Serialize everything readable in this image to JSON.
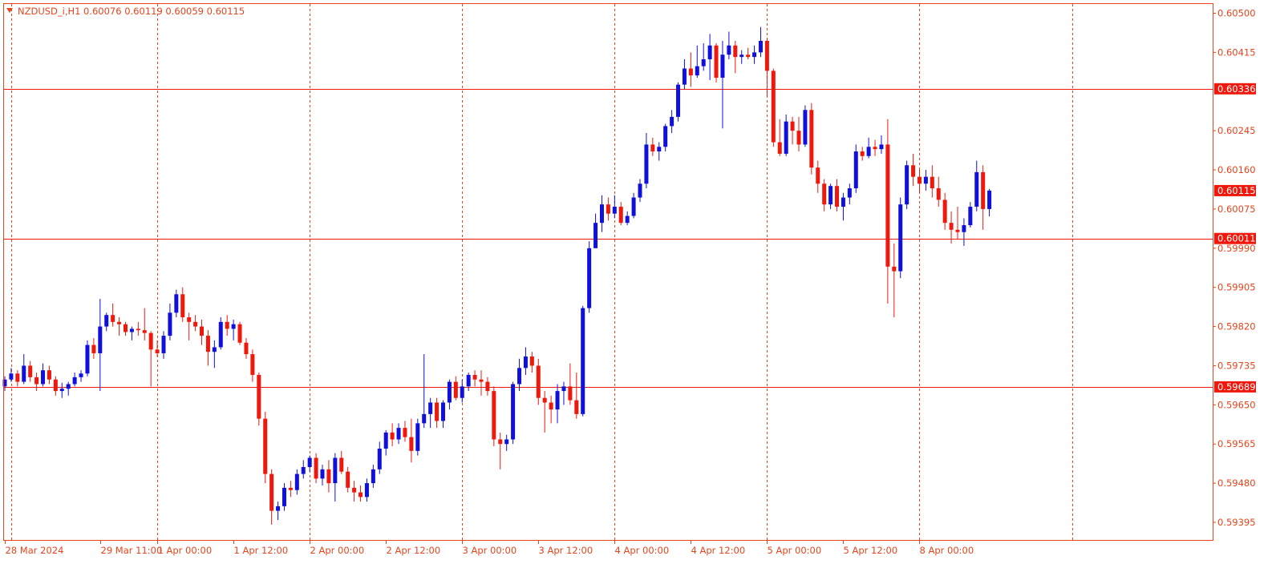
{
  "header": {
    "symbol": "NZDUSD_i,H1",
    "ohlc": "0.60076 0.60119 0.60059 0.60115"
  },
  "colors": {
    "frame": "#e8441c",
    "grid": "#e8441c",
    "bull": "#1010dd",
    "bear": "#f0180c",
    "hline": "#f0180c",
    "text": "#e8441c",
    "label_bg": "#f0180c",
    "label_text": "#ffffff",
    "background": "#ffffff"
  },
  "chart_data": {
    "type": "candlestick",
    "timeframe": "H1",
    "ylim": [
      0.59355,
      0.6052
    ],
    "y_ticks": [
      "0.60500",
      "0.60415",
      "0.60245",
      "0.60160",
      "0.60075",
      "0.59990",
      "0.59905",
      "0.59820",
      "0.59735",
      "0.59650",
      "0.59565",
      "0.59480",
      "0.59395"
    ],
    "x_ticks": [
      {
        "label": "28 Mar 2024",
        "bar": 0
      },
      {
        "label": "29 Mar 11:00",
        "bar": 15
      },
      {
        "label": "1 Apr 00:00",
        "bar": 24
      },
      {
        "label": "1 Apr 12:00",
        "bar": 36
      },
      {
        "label": "2 Apr 00:00",
        "bar": 48
      },
      {
        "label": "2 Apr 12:00",
        "bar": 60
      },
      {
        "label": "3 Apr 00:00",
        "bar": 72
      },
      {
        "label": "3 Apr 12:00",
        "bar": 84
      },
      {
        "label": "4 Apr 00:00",
        "bar": 96
      },
      {
        "label": "4 Apr 12:00",
        "bar": 108
      },
      {
        "label": "5 Apr 00:00",
        "bar": 120
      },
      {
        "label": "5 Apr 12:00",
        "bar": 132
      },
      {
        "label": "8 Apr 00:00",
        "bar": 144
      }
    ],
    "vgrid_bars": [
      1,
      24,
      48,
      72,
      96,
      120,
      144,
      168
    ],
    "price_levels": [
      {
        "label": "0.60336",
        "value": 0.60336
      },
      {
        "label": "0.60011",
        "value": 0.60011
      },
      {
        "label": "0.59689",
        "value": 0.59689
      }
    ],
    "current_price": {
      "label": "0.60115",
      "value": 0.60115
    },
    "candles": [
      [
        0.5969,
        0.59712,
        0.5968,
        0.59705
      ],
      [
        0.59705,
        0.5973,
        0.597,
        0.59718
      ],
      [
        0.59718,
        0.59725,
        0.5969,
        0.597
      ],
      [
        0.597,
        0.5976,
        0.59695,
        0.59735
      ],
      [
        0.59735,
        0.59745,
        0.597,
        0.5971
      ],
      [
        0.5971,
        0.5972,
        0.5968,
        0.59695
      ],
      [
        0.59695,
        0.5974,
        0.5969,
        0.59725
      ],
      [
        0.59725,
        0.59735,
        0.59695,
        0.59705
      ],
      [
        0.59705,
        0.59712,
        0.5967,
        0.5968
      ],
      [
        0.5968,
        0.59698,
        0.59665,
        0.59685
      ],
      [
        0.59685,
        0.597,
        0.5967,
        0.59695
      ],
      [
        0.59695,
        0.5972,
        0.5969,
        0.5971
      ],
      [
        0.5971,
        0.59725,
        0.597,
        0.59718
      ],
      [
        0.59718,
        0.5979,
        0.59712,
        0.5978
      ],
      [
        0.5978,
        0.59795,
        0.5975,
        0.59762
      ],
      [
        0.59762,
        0.5988,
        0.5968,
        0.5982
      ],
      [
        0.5982,
        0.5985,
        0.5981,
        0.59845
      ],
      [
        0.59845,
        0.5987,
        0.5982,
        0.5983
      ],
      [
        0.5983,
        0.5984,
        0.598,
        0.59825
      ],
      [
        0.59825,
        0.5983,
        0.598,
        0.59808
      ],
      [
        0.59808,
        0.5982,
        0.5979,
        0.59815
      ],
      [
        0.59815,
        0.5983,
        0.598,
        0.59812
      ],
      [
        0.59812,
        0.5986,
        0.5979,
        0.59806
      ],
      [
        0.59806,
        0.5981,
        0.5969,
        0.5977
      ],
      [
        0.5977,
        0.5979,
        0.59755,
        0.59762
      ],
      [
        0.59762,
        0.5981,
        0.5975,
        0.598
      ],
      [
        0.598,
        0.5987,
        0.5979,
        0.5985
      ],
      [
        0.5985,
        0.599,
        0.5984,
        0.5989
      ],
      [
        0.5989,
        0.59905,
        0.5983,
        0.5984
      ],
      [
        0.5984,
        0.5985,
        0.5979,
        0.5983
      ],
      [
        0.5983,
        0.59845,
        0.5981,
        0.5982
      ],
      [
        0.5982,
        0.59835,
        0.5978,
        0.598
      ],
      [
        0.598,
        0.59812,
        0.59735,
        0.59765
      ],
      [
        0.59765,
        0.5979,
        0.5973,
        0.59775
      ],
      [
        0.59775,
        0.5984,
        0.5977,
        0.5983
      ],
      [
        0.5983,
        0.59845,
        0.598,
        0.59815
      ],
      [
        0.59815,
        0.59835,
        0.5979,
        0.59825
      ],
      [
        0.59825,
        0.5983,
        0.5978,
        0.59785
      ],
      [
        0.59785,
        0.59795,
        0.5975,
        0.5976
      ],
      [
        0.5976,
        0.5977,
        0.597,
        0.59715
      ],
      [
        0.59715,
        0.5972,
        0.59605,
        0.5962
      ],
      [
        0.5962,
        0.59635,
        0.5948,
        0.595
      ],
      [
        0.595,
        0.5951,
        0.5939,
        0.5942
      ],
      [
        0.5942,
        0.5944,
        0.594,
        0.5943
      ],
      [
        0.5943,
        0.5948,
        0.5942,
        0.5947
      ],
      [
        0.5947,
        0.59485,
        0.5945,
        0.59465
      ],
      [
        0.59465,
        0.5951,
        0.59455,
        0.595
      ],
      [
        0.595,
        0.5953,
        0.5949,
        0.59515
      ],
      [
        0.59515,
        0.5954,
        0.59505,
        0.59535
      ],
      [
        0.59535,
        0.59545,
        0.5948,
        0.5949
      ],
      [
        0.5949,
        0.5952,
        0.59475,
        0.5951
      ],
      [
        0.5951,
        0.5953,
        0.5946,
        0.5948
      ],
      [
        0.5948,
        0.59545,
        0.5944,
        0.59535
      ],
      [
        0.59535,
        0.5955,
        0.595,
        0.59505
      ],
      [
        0.59505,
        0.59515,
        0.5946,
        0.5947
      ],
      [
        0.5947,
        0.59485,
        0.5944,
        0.5946
      ],
      [
        0.5946,
        0.59475,
        0.5944,
        0.5945
      ],
      [
        0.5945,
        0.5949,
        0.5944,
        0.5948
      ],
      [
        0.5948,
        0.5952,
        0.5947,
        0.5951
      ],
      [
        0.5951,
        0.5957,
        0.595,
        0.59555
      ],
      [
        0.59555,
        0.59595,
        0.5954,
        0.5959
      ],
      [
        0.5959,
        0.5961,
        0.5956,
        0.59575
      ],
      [
        0.59575,
        0.5961,
        0.59565,
        0.596
      ],
      [
        0.596,
        0.59615,
        0.5957,
        0.5958
      ],
      [
        0.5958,
        0.5962,
        0.59525,
        0.5955
      ],
      [
        0.5955,
        0.5962,
        0.5954,
        0.5961
      ],
      [
        0.5961,
        0.5976,
        0.596,
        0.5963
      ],
      [
        0.5963,
        0.59665,
        0.596,
        0.59655
      ],
      [
        0.59655,
        0.59665,
        0.596,
        0.59615
      ],
      [
        0.59615,
        0.5966,
        0.596,
        0.59655
      ],
      [
        0.59655,
        0.59705,
        0.5964,
        0.597
      ],
      [
        0.597,
        0.59712,
        0.5966,
        0.59665
      ],
      [
        0.59665,
        0.59705,
        0.59655,
        0.5969
      ],
      [
        0.5969,
        0.5972,
        0.5968,
        0.59715
      ],
      [
        0.59715,
        0.59725,
        0.5969,
        0.59705
      ],
      [
        0.59705,
        0.59725,
        0.5967,
        0.597
      ],
      [
        0.597,
        0.5971,
        0.5967,
        0.5968
      ],
      [
        0.5968,
        0.5969,
        0.5956,
        0.59575
      ],
      [
        0.59575,
        0.5959,
        0.5951,
        0.59565
      ],
      [
        0.59565,
        0.59585,
        0.5955,
        0.59575
      ],
      [
        0.59575,
        0.597,
        0.59565,
        0.59695
      ],
      [
        0.59695,
        0.5975,
        0.5968,
        0.5973
      ],
      [
        0.5973,
        0.59775,
        0.59715,
        0.59755
      ],
      [
        0.59755,
        0.59765,
        0.5972,
        0.59735
      ],
      [
        0.59735,
        0.5975,
        0.5965,
        0.59665
      ],
      [
        0.59665,
        0.5968,
        0.5959,
        0.59655
      ],
      [
        0.59655,
        0.5967,
        0.5961,
        0.5964
      ],
      [
        0.5964,
        0.59695,
        0.5961,
        0.5968
      ],
      [
        0.5968,
        0.597,
        0.5965,
        0.5969
      ],
      [
        0.5969,
        0.5974,
        0.5965,
        0.5966
      ],
      [
        0.5966,
        0.5972,
        0.5962,
        0.5963
      ],
      [
        0.5963,
        0.59865,
        0.59625,
        0.5986
      ],
      [
        0.5986,
        0.60005,
        0.5985,
        0.5999
      ],
      [
        0.5999,
        0.60065,
        0.5999,
        0.60045
      ],
      [
        0.60045,
        0.60105,
        0.60025,
        0.60085
      ],
      [
        0.60085,
        0.601,
        0.6005,
        0.60065
      ],
      [
        0.60065,
        0.60105,
        0.60055,
        0.6008
      ],
      [
        0.6008,
        0.6009,
        0.6004,
        0.60045
      ],
      [
        0.60045,
        0.6007,
        0.6004,
        0.6006
      ],
      [
        0.6006,
        0.6011,
        0.60055,
        0.601
      ],
      [
        0.601,
        0.6014,
        0.6009,
        0.6013
      ],
      [
        0.6013,
        0.6024,
        0.6012,
        0.60215
      ],
      [
        0.60215,
        0.6023,
        0.6019,
        0.602
      ],
      [
        0.602,
        0.6022,
        0.6018,
        0.6021
      ],
      [
        0.6021,
        0.6026,
        0.602,
        0.60255
      ],
      [
        0.60255,
        0.6029,
        0.6024,
        0.60275
      ],
      [
        0.60275,
        0.6035,
        0.60265,
        0.60345
      ],
      [
        0.60345,
        0.604,
        0.60335,
        0.6038
      ],
      [
        0.6038,
        0.60415,
        0.6034,
        0.60365
      ],
      [
        0.60365,
        0.6043,
        0.6036,
        0.60385
      ],
      [
        0.60385,
        0.60435,
        0.60375,
        0.604
      ],
      [
        0.604,
        0.60455,
        0.60355,
        0.6043
      ],
      [
        0.6043,
        0.60435,
        0.6035,
        0.6036
      ],
      [
        0.6036,
        0.6044,
        0.6025,
        0.6041
      ],
      [
        0.6041,
        0.6046,
        0.604,
        0.6043
      ],
      [
        0.6043,
        0.6044,
        0.6037,
        0.60405
      ],
      [
        0.60405,
        0.6042,
        0.6039,
        0.6041
      ],
      [
        0.6041,
        0.60425,
        0.604,
        0.60405
      ],
      [
        0.60405,
        0.6043,
        0.6039,
        0.60415
      ],
      [
        0.60415,
        0.6047,
        0.60405,
        0.6044
      ],
      [
        0.6044,
        0.60445,
        0.6032,
        0.60375
      ],
      [
        0.60375,
        0.6038,
        0.6021,
        0.6022
      ],
      [
        0.6022,
        0.6027,
        0.6019,
        0.60195
      ],
      [
        0.60195,
        0.6028,
        0.6019,
        0.60265
      ],
      [
        0.60265,
        0.60275,
        0.60215,
        0.60245
      ],
      [
        0.60245,
        0.60275,
        0.602,
        0.60215
      ],
      [
        0.60215,
        0.603,
        0.6021,
        0.6029
      ],
      [
        0.6029,
        0.60305,
        0.6015,
        0.60165
      ],
      [
        0.60165,
        0.6018,
        0.6011,
        0.6013
      ],
      [
        0.6013,
        0.6014,
        0.6007,
        0.60085
      ],
      [
        0.60085,
        0.6013,
        0.60075,
        0.60125
      ],
      [
        0.60125,
        0.6014,
        0.6007,
        0.6008
      ],
      [
        0.6008,
        0.6011,
        0.6005,
        0.601
      ],
      [
        0.601,
        0.6013,
        0.60085,
        0.6012
      ],
      [
        0.6012,
        0.60215,
        0.6011,
        0.602
      ],
      [
        0.602,
        0.6021,
        0.6018,
        0.6019
      ],
      [
        0.6019,
        0.6023,
        0.60185,
        0.6021
      ],
      [
        0.6021,
        0.60225,
        0.6019,
        0.60205
      ],
      [
        0.60205,
        0.60235,
        0.60195,
        0.60215
      ],
      [
        0.60215,
        0.6027,
        0.5987,
        0.5995
      ],
      [
        0.5995,
        0.6,
        0.5984,
        0.5994
      ],
      [
        0.5994,
        0.601,
        0.59925,
        0.60085
      ],
      [
        0.60085,
        0.6018,
        0.60075,
        0.6017
      ],
      [
        0.6017,
        0.60195,
        0.60125,
        0.60145
      ],
      [
        0.60145,
        0.6016,
        0.6011,
        0.6013
      ],
      [
        0.6013,
        0.6016,
        0.60115,
        0.60145
      ],
      [
        0.60145,
        0.6017,
        0.601,
        0.6012
      ],
      [
        0.6012,
        0.60145,
        0.6008,
        0.60095
      ],
      [
        0.60095,
        0.6011,
        0.6003,
        0.60045
      ],
      [
        0.60045,
        0.6007,
        0.6,
        0.6003
      ],
      [
        0.6003,
        0.6008,
        0.6001,
        0.60025
      ],
      [
        0.60025,
        0.60055,
        0.59995,
        0.6004
      ],
      [
        0.6004,
        0.6009,
        0.60035,
        0.6008
      ],
      [
        0.6008,
        0.6018,
        0.6007,
        0.60155
      ],
      [
        0.60155,
        0.6017,
        0.6003,
        0.60075
      ],
      [
        0.60075,
        0.60119,
        0.60059,
        0.60115
      ]
    ]
  }
}
